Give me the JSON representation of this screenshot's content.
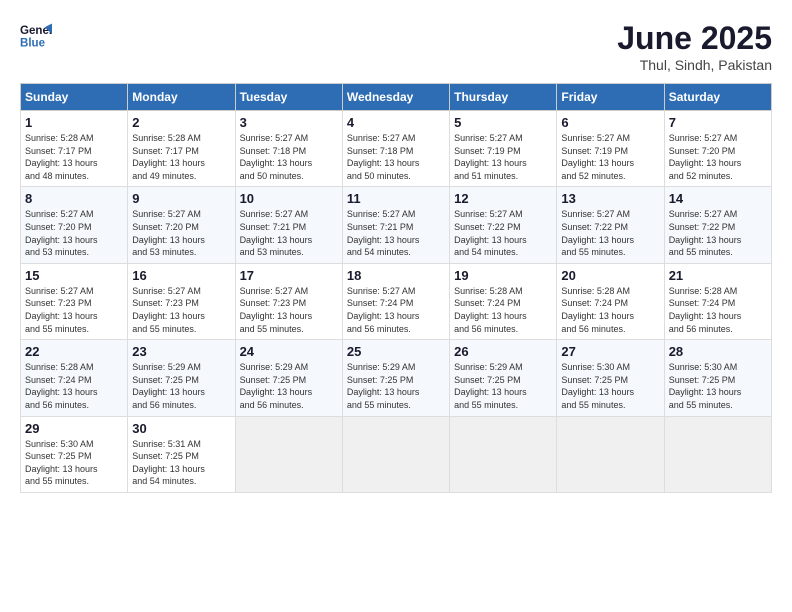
{
  "header": {
    "logo_line1": "General",
    "logo_line2": "Blue",
    "title": "June 2025",
    "subtitle": "Thul, Sindh, Pakistan"
  },
  "calendar": {
    "days_of_week": [
      "Sunday",
      "Monday",
      "Tuesday",
      "Wednesday",
      "Thursday",
      "Friday",
      "Saturday"
    ],
    "weeks": [
      [
        {
          "day": "",
          "info": ""
        },
        {
          "day": "2",
          "info": "Sunrise: 5:28 AM\nSunset: 7:17 PM\nDaylight: 13 hours\nand 49 minutes."
        },
        {
          "day": "3",
          "info": "Sunrise: 5:27 AM\nSunset: 7:18 PM\nDaylight: 13 hours\nand 50 minutes."
        },
        {
          "day": "4",
          "info": "Sunrise: 5:27 AM\nSunset: 7:18 PM\nDaylight: 13 hours\nand 50 minutes."
        },
        {
          "day": "5",
          "info": "Sunrise: 5:27 AM\nSunset: 7:19 PM\nDaylight: 13 hours\nand 51 minutes."
        },
        {
          "day": "6",
          "info": "Sunrise: 5:27 AM\nSunset: 7:19 PM\nDaylight: 13 hours\nand 52 minutes."
        },
        {
          "day": "7",
          "info": "Sunrise: 5:27 AM\nSunset: 7:20 PM\nDaylight: 13 hours\nand 52 minutes."
        }
      ],
      [
        {
          "day": "1",
          "info": "Sunrise: 5:28 AM\nSunset: 7:17 PM\nDaylight: 13 hours\nand 48 minutes."
        },
        {
          "day": "9",
          "info": "Sunrise: 5:27 AM\nSunset: 7:20 PM\nDaylight: 13 hours\nand 53 minutes."
        },
        {
          "day": "10",
          "info": "Sunrise: 5:27 AM\nSunset: 7:21 PM\nDaylight: 13 hours\nand 53 minutes."
        },
        {
          "day": "11",
          "info": "Sunrise: 5:27 AM\nSunset: 7:21 PM\nDaylight: 13 hours\nand 54 minutes."
        },
        {
          "day": "12",
          "info": "Sunrise: 5:27 AM\nSunset: 7:22 PM\nDaylight: 13 hours\nand 54 minutes."
        },
        {
          "day": "13",
          "info": "Sunrise: 5:27 AM\nSunset: 7:22 PM\nDaylight: 13 hours\nand 55 minutes."
        },
        {
          "day": "14",
          "info": "Sunrise: 5:27 AM\nSunset: 7:22 PM\nDaylight: 13 hours\nand 55 minutes."
        }
      ],
      [
        {
          "day": "8",
          "info": "Sunrise: 5:27 AM\nSunset: 7:20 PM\nDaylight: 13 hours\nand 53 minutes."
        },
        {
          "day": "16",
          "info": "Sunrise: 5:27 AM\nSunset: 7:23 PM\nDaylight: 13 hours\nand 55 minutes."
        },
        {
          "day": "17",
          "info": "Sunrise: 5:27 AM\nSunset: 7:23 PM\nDaylight: 13 hours\nand 55 minutes."
        },
        {
          "day": "18",
          "info": "Sunrise: 5:27 AM\nSunset: 7:24 PM\nDaylight: 13 hours\nand 56 minutes."
        },
        {
          "day": "19",
          "info": "Sunrise: 5:28 AM\nSunset: 7:24 PM\nDaylight: 13 hours\nand 56 minutes."
        },
        {
          "day": "20",
          "info": "Sunrise: 5:28 AM\nSunset: 7:24 PM\nDaylight: 13 hours\nand 56 minutes."
        },
        {
          "day": "21",
          "info": "Sunrise: 5:28 AM\nSunset: 7:24 PM\nDaylight: 13 hours\nand 56 minutes."
        }
      ],
      [
        {
          "day": "15",
          "info": "Sunrise: 5:27 AM\nSunset: 7:23 PM\nDaylight: 13 hours\nand 55 minutes."
        },
        {
          "day": "23",
          "info": "Sunrise: 5:29 AM\nSunset: 7:25 PM\nDaylight: 13 hours\nand 56 minutes."
        },
        {
          "day": "24",
          "info": "Sunrise: 5:29 AM\nSunset: 7:25 PM\nDaylight: 13 hours\nand 56 minutes."
        },
        {
          "day": "25",
          "info": "Sunrise: 5:29 AM\nSunset: 7:25 PM\nDaylight: 13 hours\nand 55 minutes."
        },
        {
          "day": "26",
          "info": "Sunrise: 5:29 AM\nSunset: 7:25 PM\nDaylight: 13 hours\nand 55 minutes."
        },
        {
          "day": "27",
          "info": "Sunrise: 5:30 AM\nSunset: 7:25 PM\nDaylight: 13 hours\nand 55 minutes."
        },
        {
          "day": "28",
          "info": "Sunrise: 5:30 AM\nSunset: 7:25 PM\nDaylight: 13 hours\nand 55 minutes."
        }
      ],
      [
        {
          "day": "22",
          "info": "Sunrise: 5:28 AM\nSunset: 7:24 PM\nDaylight: 13 hours\nand 56 minutes."
        },
        {
          "day": "30",
          "info": "Sunrise: 5:31 AM\nSunset: 7:25 PM\nDaylight: 13 hours\nand 54 minutes."
        },
        {
          "day": "",
          "info": ""
        },
        {
          "day": "",
          "info": ""
        },
        {
          "day": "",
          "info": ""
        },
        {
          "day": "",
          "info": ""
        },
        {
          "day": ""
        }
      ],
      [
        {
          "day": "29",
          "info": "Sunrise: 5:30 AM\nSunset: 7:25 PM\nDaylight: 13 hours\nand 55 minutes."
        },
        {
          "day": "",
          "info": ""
        },
        {
          "day": "",
          "info": ""
        },
        {
          "day": "",
          "info": ""
        },
        {
          "day": "",
          "info": ""
        },
        {
          "day": "",
          "info": ""
        },
        {
          "day": "",
          "info": ""
        }
      ]
    ]
  }
}
